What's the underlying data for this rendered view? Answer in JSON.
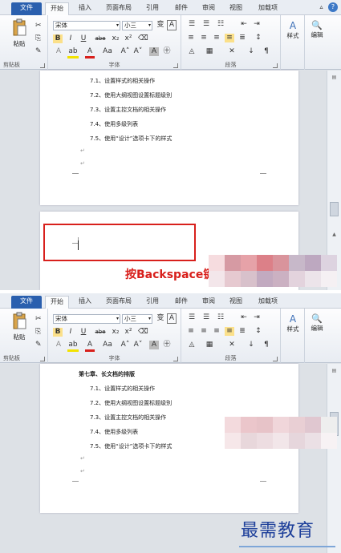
{
  "tabs": [
    "文件",
    "开始",
    "插入",
    "页面布局",
    "引用",
    "邮件",
    "审阅",
    "视图",
    "加载项"
  ],
  "ribbon": {
    "paste_label": "粘贴",
    "clipboard_label": "剪贴板",
    "font_label": "字体",
    "paragraph_label": "段落",
    "styles_label": "样式",
    "edit_label": "编辑",
    "font_name": "宋体",
    "font_size": "小三",
    "wen_glyph": "变",
    "A_glyph": "A"
  },
  "shot1_lines": [
    "7.1、设置样式的相关操作",
    "7.2、使用大纲视图设置标题级别",
    "7.3、设置主控文档的相关操作",
    "7.4、使用多级列表",
    "7.5、使用“设计”选项卡下的样式"
  ],
  "caption": "按Backspace键",
  "shot2_heading": "第七章、长文档的排版",
  "shot2_lines": [
    "7.1、设置样式的相关操作",
    "7.2、使用大纲视图设置标题级别",
    "7.3、设置主控文档的相关操作",
    "7.4、使用多级列表",
    "7.5、使用“设计”选项卡下的样式"
  ],
  "watermark": "最需教育",
  "colors": {
    "file_tab": "#2a5fae",
    "highlight": "#d8201c",
    "watermark": "#1d3f9a"
  }
}
